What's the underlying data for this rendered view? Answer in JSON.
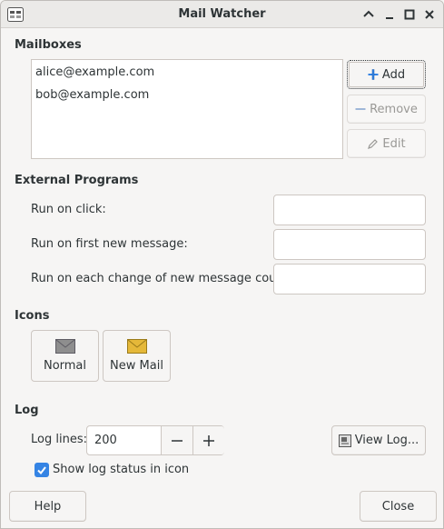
{
  "window": {
    "title": "Mail Watcher"
  },
  "mailboxes": {
    "heading": "Mailboxes",
    "items": [
      "alice@example.com",
      "bob@example.com"
    ],
    "add_label": "Add",
    "remove_label": "Remove",
    "edit_label": "Edit"
  },
  "external_programs": {
    "heading": "External Programs",
    "run_on_click_label": "Run on click:",
    "run_on_first_label": "Run on first new message:",
    "run_on_change_label": "Run on each change of new message count:",
    "run_on_click_value": "",
    "run_on_first_value": "",
    "run_on_change_value": ""
  },
  "icons": {
    "heading": "Icons",
    "normal_label": "Normal",
    "new_mail_label": "New Mail"
  },
  "log": {
    "heading": "Log",
    "log_lines_label": "Log lines:",
    "log_lines_value": "200",
    "view_log_label": "View Log...",
    "show_status_label": "Show log status in icon",
    "show_status_checked": true
  },
  "footer": {
    "help_label": "Help",
    "close_label": "Close"
  },
  "colors": {
    "accent": "#3584e4",
    "envelope_normal": "#8e8e8e",
    "envelope_new": "#e5b839"
  }
}
